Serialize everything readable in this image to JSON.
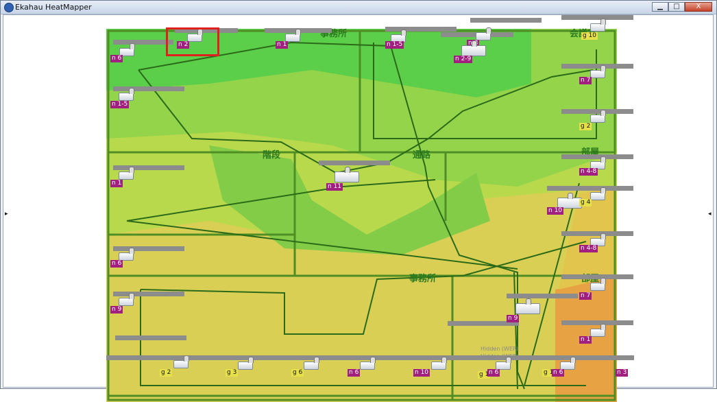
{
  "window": {
    "title": "Ekahau HeatMapper"
  },
  "controls": {
    "minimize": "▁",
    "maximize": "□",
    "close": "X"
  },
  "side_arrows": {
    "left": "▸",
    "right": "◂"
  },
  "rooms": [
    "事務所",
    "会議室",
    "階段",
    "通路",
    "部屋",
    "事務所",
    "部屋"
  ],
  "access_points": [
    {
      "label": "n 6"
    },
    {
      "label": "n 2"
    },
    {
      "label": "n 1"
    },
    {
      "label": "n 1-5"
    },
    {
      "label": "n 8"
    },
    {
      "label": "n 2-9"
    },
    {
      "label": "g 10"
    },
    {
      "label": "n 7"
    },
    {
      "label": "n 1-5"
    },
    {
      "label": "g 2"
    },
    {
      "label": "n 1"
    },
    {
      "label": "n 11"
    },
    {
      "label": "n 4-8"
    },
    {
      "label": "n 10"
    },
    {
      "label": "g 4"
    },
    {
      "label": "n 4-8"
    },
    {
      "label": "n 6"
    },
    {
      "label": "n 9"
    },
    {
      "label": "n 7"
    },
    {
      "label": "n 9"
    },
    {
      "label": "n 1"
    },
    {
      "label": "g 2"
    },
    {
      "label": "g 3"
    },
    {
      "label": "g 6"
    },
    {
      "label": "n 6"
    },
    {
      "label": "n 10"
    },
    {
      "label": "g 1"
    },
    {
      "label": "n 6"
    },
    {
      "label": "g 1"
    },
    {
      "label": "n 6"
    },
    {
      "label": "n 3"
    }
  ],
  "hidden": [
    "Hidden (WEP)",
    "Hidden (WEP)"
  ]
}
